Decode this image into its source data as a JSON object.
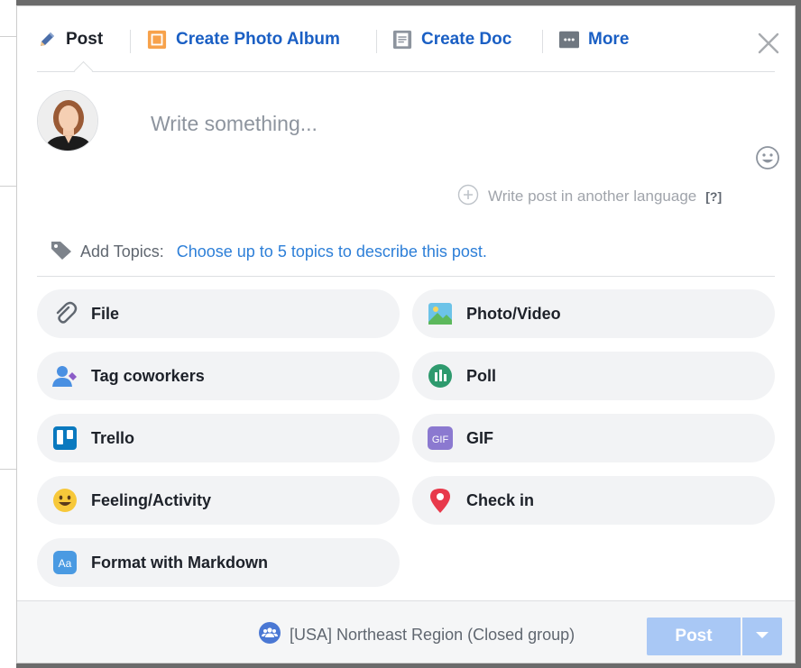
{
  "tabs": [
    {
      "label": "Post",
      "icon": "pencil-icon",
      "active": true
    },
    {
      "label": "Create Photo Album",
      "icon": "photo-album-icon",
      "active": false
    },
    {
      "label": "Create Doc",
      "icon": "document-icon",
      "active": false
    },
    {
      "label": "More",
      "icon": "more-icon",
      "active": false
    }
  ],
  "close_icon": "close-icon",
  "composer": {
    "placeholder": "Write something...",
    "language_link": "Write post in another language",
    "language_help": "[?]"
  },
  "topics": {
    "label": "Add Topics:",
    "link": "Choose up to 5 topics to describe this post."
  },
  "options": [
    {
      "label": "File",
      "icon": "paperclip-icon"
    },
    {
      "label": "Photo/Video",
      "icon": "photo-video-icon"
    },
    {
      "label": "Tag coworkers",
      "icon": "tag-coworkers-icon"
    },
    {
      "label": "Poll",
      "icon": "poll-icon"
    },
    {
      "label": "Trello",
      "icon": "trello-icon"
    },
    {
      "label": "GIF",
      "icon": "gif-icon",
      "icon_text": "GIF"
    },
    {
      "label": "Feeling/Activity",
      "icon": "smiley-icon"
    },
    {
      "label": "Check in",
      "icon": "location-pin-icon"
    },
    {
      "label": "Format with Markdown",
      "icon": "markdown-icon",
      "icon_text": "Aa"
    }
  ],
  "footer": {
    "audience": "[USA] Northeast Region  (Closed group)",
    "audience_icon": "group-icon",
    "post_button": "Post",
    "post_dropdown_icon": "chevron-down-icon"
  },
  "colors": {
    "link": "#1a5fc4",
    "post_button": "#a9c8f5",
    "option_bg": "#f2f3f5"
  }
}
